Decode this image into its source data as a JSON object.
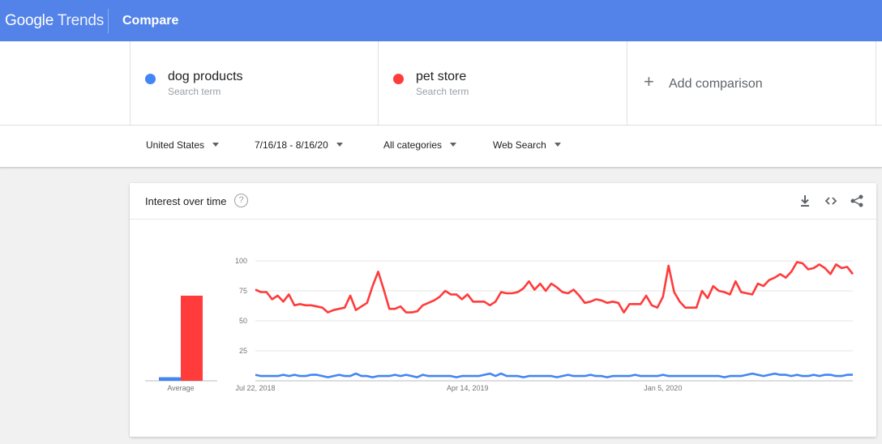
{
  "header": {
    "logo_google": "Google",
    "logo_trends": "Trends",
    "page_title": "Compare"
  },
  "terms": [
    {
      "name": "dog products",
      "sub": "Search term",
      "color": "#4285f4"
    },
    {
      "name": "pet store",
      "sub": "Search term",
      "color": "#ff3b3b"
    }
  ],
  "add_comparison": {
    "label": "Add comparison"
  },
  "filters": {
    "region": "United States",
    "date_range": "7/16/18 - 8/16/20",
    "category": "All categories",
    "search_type": "Web Search"
  },
  "card": {
    "title": "Interest over time",
    "help_icon": "help-icon",
    "actions": [
      "download-icon",
      "embed-icon",
      "share-icon"
    ]
  },
  "chart_data": {
    "type": "line",
    "y_ticks": [
      25,
      50,
      75,
      100
    ],
    "ylim": [
      0,
      100
    ],
    "x_tick_labels": [
      "Jul 22, 2018",
      "Apr 14, 2019",
      "Jan 5, 2020"
    ],
    "x_tick_index": [
      0,
      38,
      73
    ],
    "average": {
      "label": "Average",
      "values": [
        3,
        71
      ]
    },
    "series": [
      {
        "name": "dog products",
        "color": "#4285f4",
        "values": [
          5,
          4,
          4,
          4,
          4,
          5,
          4,
          5,
          4,
          4,
          5,
          5,
          4,
          3,
          4,
          5,
          4,
          4,
          6,
          4,
          4,
          3,
          4,
          4,
          4,
          5,
          4,
          5,
          4,
          3,
          5,
          4,
          4,
          4,
          4,
          4,
          3,
          4,
          4,
          4,
          4,
          5,
          6,
          4,
          6,
          4,
          4,
          4,
          3,
          4,
          4,
          4,
          4,
          4,
          3,
          4,
          5,
          4,
          4,
          4,
          5,
          4,
          4,
          3,
          4,
          4,
          4,
          4,
          5,
          4,
          4,
          4,
          4,
          5,
          4,
          4,
          4,
          4,
          4,
          4,
          4,
          4,
          4,
          4,
          3,
          4,
          4,
          4,
          5,
          6,
          5,
          4,
          5,
          6,
          5,
          5,
          4,
          5,
          4,
          4,
          5,
          4,
          5,
          5,
          4,
          4,
          5,
          5
        ]
      },
      {
        "name": "pet store",
        "color": "#ff3b3b",
        "values": [
          76,
          74,
          74,
          68,
          71,
          66,
          72,
          63,
          64,
          63,
          63,
          62,
          61,
          57,
          59,
          60,
          61,
          71,
          59,
          62,
          65,
          79,
          91,
          76,
          60,
          60,
          62,
          57,
          57,
          58,
          63,
          65,
          67,
          70,
          75,
          72,
          72,
          68,
          72,
          66,
          66,
          66,
          63,
          66,
          74,
          73,
          73,
          74,
          77,
          83,
          76,
          81,
          75,
          81,
          78,
          74,
          73,
          76,
          71,
          65,
          66,
          68,
          67,
          65,
          66,
          65,
          57,
          64,
          64,
          64,
          71,
          63,
          61,
          70,
          96,
          74,
          66,
          61,
          61,
          61,
          75,
          69,
          79,
          75,
          74,
          72,
          83,
          74,
          73,
          72,
          81,
          79,
          84,
          86,
          89,
          86,
          91,
          99,
          98,
          93,
          94,
          97,
          94,
          89,
          97,
          94,
          95,
          89
        ]
      }
    ]
  }
}
